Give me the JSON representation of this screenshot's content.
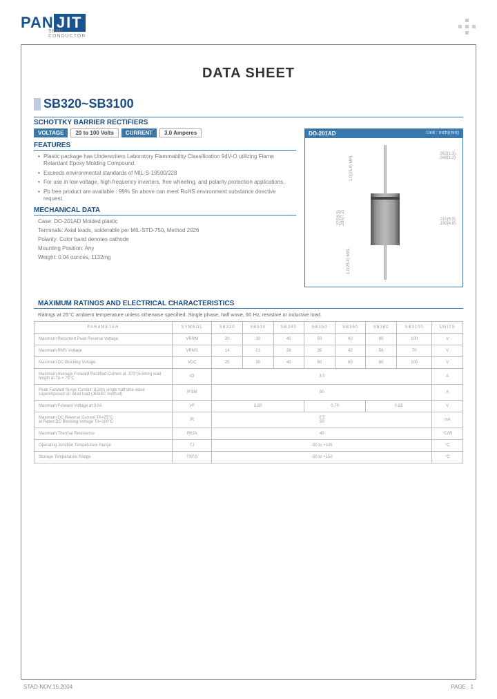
{
  "logo": {
    "part1": "PAN",
    "part2": "JIT",
    "sub": "SEMI\nCONDUCTOR"
  },
  "doc_title": "DATA  SHEET",
  "part_number": "SB320~SB3100",
  "subtitle": "SCHOTTKY BARRIER RECTIFIERS",
  "voltage_label": "VOLTAGE",
  "voltage_value": "20 to 100 Volts",
  "current_label": "CURRENT",
  "current_value": "3.0 Amperes",
  "features_hdr": "FEATURES",
  "features": [
    "Plastic package has Underwriters Laboratory Flammability Classification 94V-O utilizing Flame Retardant Epoxy Molding Compound.",
    "Exceeds environmental standards of MIL-S-19500/228",
    "For use in low voltage, high frequency inverters, free wheeling, and polarity protection applications.",
    "Pb free product are available : 99% Sn above can meet RoHS environment substance directive request."
  ],
  "mech_hdr": "MECHANICAL DATA",
  "mech": {
    "case": "Case: DO-201AD Molded plastic",
    "terminals": "Terminals: Axial leads, solderable per MIL-STD-750, Method 2026",
    "polarity": "Polarity:  Color band denotes cathode",
    "mounting": "Mounting Position: Any",
    "weight": "Weight: 0.04 ounces, 1132mg"
  },
  "pkg": {
    "title": "DO-201AD",
    "unit": "Unit : inch(mm)"
  },
  "pkg_dims": {
    "lead_dia": ".052(1.3)\n.048(1.2)",
    "lead_len": "1.0(25.4) MIN.",
    "body_len": ".375(9.5)\n.285(7.2)",
    "lead_len2": "1.0(25.4) MIN.",
    "body_dia": ".210(5.3)\n.190(4.8)"
  },
  "ratings_title": "MAXIMUM RATINGS AND ELECTRICAL CHARACTERISTICS",
  "ratings_note": "Ratings at 25°C ambient temperature unless otherwise specified.  Single phase, half wave, 60 Hz, resistive or inductive load.",
  "chart_data": {
    "type": "table",
    "columns": [
      "PARAMETER",
      "SYMBOL",
      "SB320",
      "SB330",
      "SB340",
      "SB350",
      "SB360",
      "SB380",
      "SB3100",
      "UNITS"
    ],
    "rows": [
      {
        "param": "Maximum Recurrent Peak Reverse Voltage",
        "symbol": "VRRM",
        "v": [
          "20",
          "30",
          "40",
          "50",
          "60",
          "80",
          "100"
        ],
        "unit": "V"
      },
      {
        "param": "Maximum RMS Voltage",
        "symbol": "VRMS",
        "v": [
          "14",
          "21",
          "28",
          "35",
          "42",
          "56",
          "70"
        ],
        "unit": "V"
      },
      {
        "param": "Maximum DC Blocking Voltage",
        "symbol": "VDC",
        "v": [
          "20",
          "30",
          "40",
          "50",
          "60",
          "80",
          "100"
        ],
        "unit": "V"
      },
      {
        "param": "Maximum Average Forward Rectified Current at .375\"(9.5mm) lead length at TA = 75°C",
        "symbol": "IO",
        "span": "3.0",
        "unit": "A"
      },
      {
        "param": "Peak Forward Surge Current: 8.3ms single half sine-wave superimposed on rated load (JEDEC method)",
        "symbol": "IFSM",
        "span": "80",
        "unit": "A"
      },
      {
        "param": "Maximum Forward Voltage at 3.0A",
        "symbol": "VF",
        "v3": [
          "0.50",
          "0.70",
          "0.85"
        ],
        "unit": "V"
      },
      {
        "param": "Maximum DC Reverse Current TA=25°C\nat Rated DC Blocking Voltage TA=100°C",
        "symbol": "IR",
        "span": "0.5\n20",
        "unit": "mA"
      },
      {
        "param": "Maximum Thermal Resistance",
        "symbol": "RθJA",
        "span": "40",
        "unit": "°C/W"
      },
      {
        "param": "Operating Junction Temperature Range",
        "symbol": "TJ",
        "span": "-50 to +125",
        "unit": "°C"
      },
      {
        "param": "Storage Temperature Range",
        "symbol": "TSTG",
        "span": "-50 to +150",
        "unit": "°C"
      }
    ]
  },
  "footer": {
    "left": "STAD-NOV.15.2004",
    "right": "PAGE  .  1"
  }
}
